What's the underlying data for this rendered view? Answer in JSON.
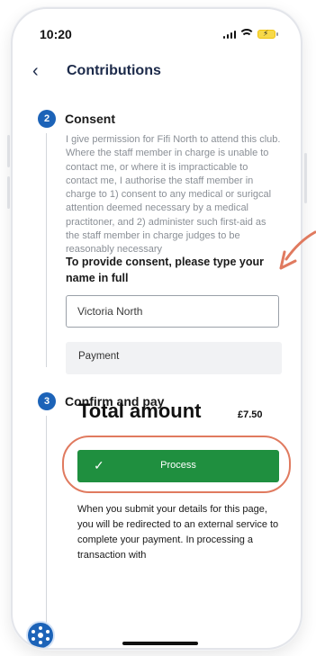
{
  "status_bar": {
    "time": "10:20"
  },
  "nav": {
    "back_icon": "‹",
    "title": "Contributions"
  },
  "consent": {
    "step_number": "2",
    "title": "Consent",
    "text": "I give permission for Fifi North to attend this club. Where the staff member in charge is unable to contact me, or where it is impracticable to contact me, I authorise the staff member in charge to 1) consent to any medical or surigcal attention deemed necessary by a medical practitoner, and 2) administer such first-aid as the staff member in charge judges to be reasonably necessary",
    "name_label": "To provide consent, please type your name in full",
    "name_value": "Victoria North"
  },
  "pay": {
    "step_number": "3",
    "title": "Confirm and pay",
    "payment_label": "Payment",
    "total_label": "Total amount",
    "total_value": "£7.50",
    "process_label": "Process",
    "process_icon": "✓",
    "footer_text": "When you submit your details for this page, you will be redirected to an external service to complete your payment. In processing a transaction with"
  },
  "colors": {
    "accent": "#1c63b8",
    "process_green": "#1f8f3f",
    "annotation": "#e07a5f"
  },
  "icons": {
    "back": "chevron-left-icon",
    "check": "check-icon",
    "fab": "palette-icon"
  }
}
